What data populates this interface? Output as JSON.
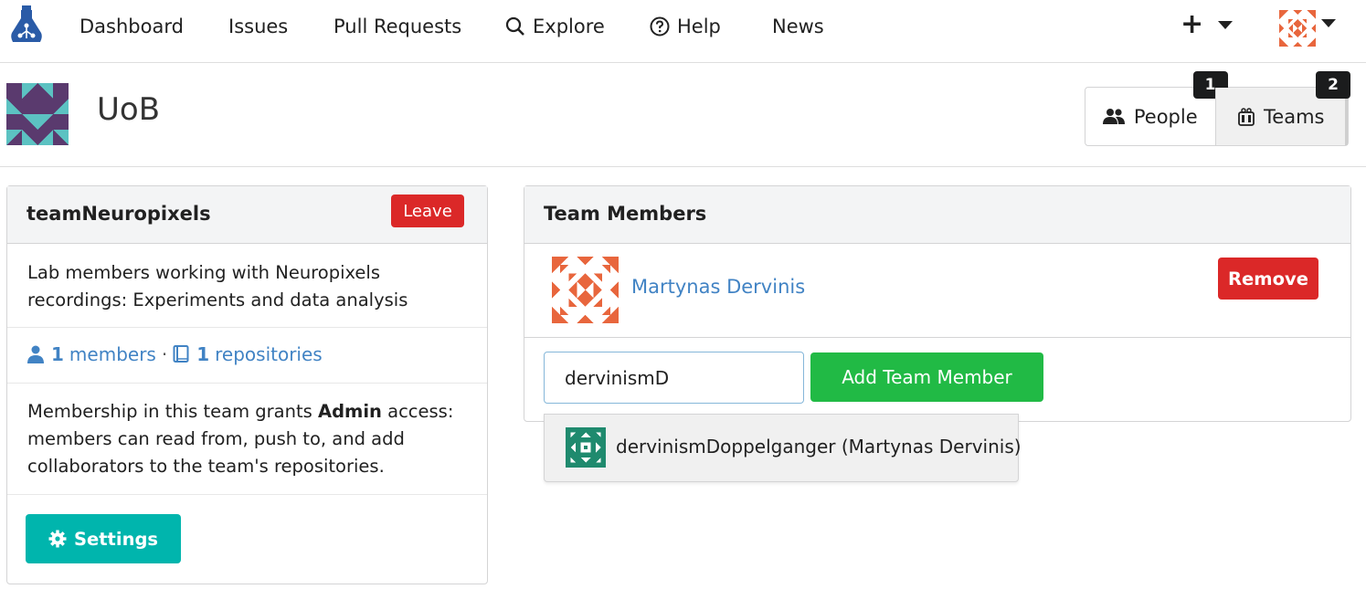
{
  "nav": {
    "items": [
      {
        "label": "Dashboard"
      },
      {
        "label": "Issues"
      },
      {
        "label": "Pull Requests"
      },
      {
        "label": "Explore",
        "icon": "search-icon"
      },
      {
        "label": "Help",
        "icon": "help-circle-icon"
      },
      {
        "label": "News"
      }
    ],
    "create_label": "+"
  },
  "org": {
    "name": "UoB",
    "tabs": [
      {
        "label": "People",
        "count": "1",
        "icon": "people-icon"
      },
      {
        "label": "Teams",
        "count": "2",
        "icon": "team-icon",
        "active": true
      }
    ]
  },
  "team": {
    "name": "teamNeuropixels",
    "leave_label": "Leave",
    "description": "Lab members working with Neuropixels recordings: Experiments and data analysis",
    "members_count": "1",
    "members_label": "members",
    "separator": "·",
    "repos_count": "1",
    "repos_label": "repositories",
    "grant_prefix": "Membership in this team grants ",
    "grant_level": "Admin",
    "grant_suffix": " access: members can read from, push to, and add collaborators to the team's repositories.",
    "settings_label": "Settings"
  },
  "members_panel": {
    "title": "Team Members",
    "members": [
      {
        "name": "Martynas Dervinis",
        "remove_label": "Remove"
      }
    ],
    "input_value": "dervinismD",
    "add_label": "Add Team Member",
    "suggestion": "dervinismDoppelganger (Martynas Dervinis)"
  },
  "colors": {
    "danger": "#db2828",
    "teal": "#00b5ad",
    "green": "#21ba45",
    "link": "#4183c4",
    "avatar_orange": "#e8663d",
    "org_purple": "#5a3a6e",
    "org_teal": "#5cc2c2",
    "suggest_green": "#1f8a6e"
  }
}
